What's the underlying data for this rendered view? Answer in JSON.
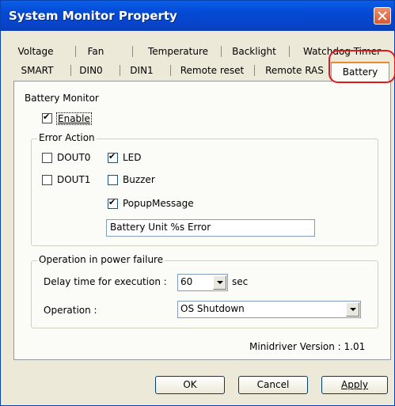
{
  "window": {
    "title": "System Monitor Property"
  },
  "tabs_row1": [
    "Voltage",
    "Fan",
    "Temperature",
    "Backlight",
    "Watchdog Timer"
  ],
  "tabs_row2": [
    "SMART",
    "DIN0",
    "DIN1",
    "Remote reset",
    "Remote RAS",
    "Battery"
  ],
  "battery_monitor": {
    "section_label": "Battery Monitor",
    "enable_label": "Enable",
    "enable_checked": true
  },
  "error_action": {
    "legend": "Error Action",
    "dout0_label": "DOUT0",
    "dout0_checked": false,
    "dout1_label": "DOUT1",
    "dout1_checked": false,
    "led_label": "LED",
    "led_checked": true,
    "buzzer_label": "Buzzer",
    "buzzer_checked": false,
    "popup_label": "PopupMessage",
    "popup_checked": true,
    "popup_message": "Battery Unit %s Error"
  },
  "power_failure": {
    "legend": "Operation in power failure",
    "delay_label": "Delay time for execution :",
    "delay_value": "60",
    "delay_unit": "sec",
    "operation_label": "Operation :",
    "operation_value": "OS Shutdown"
  },
  "version_text": "Minidriver Version : 1.01",
  "buttons": {
    "ok": "OK",
    "cancel": "Cancel",
    "apply": "Apply"
  }
}
